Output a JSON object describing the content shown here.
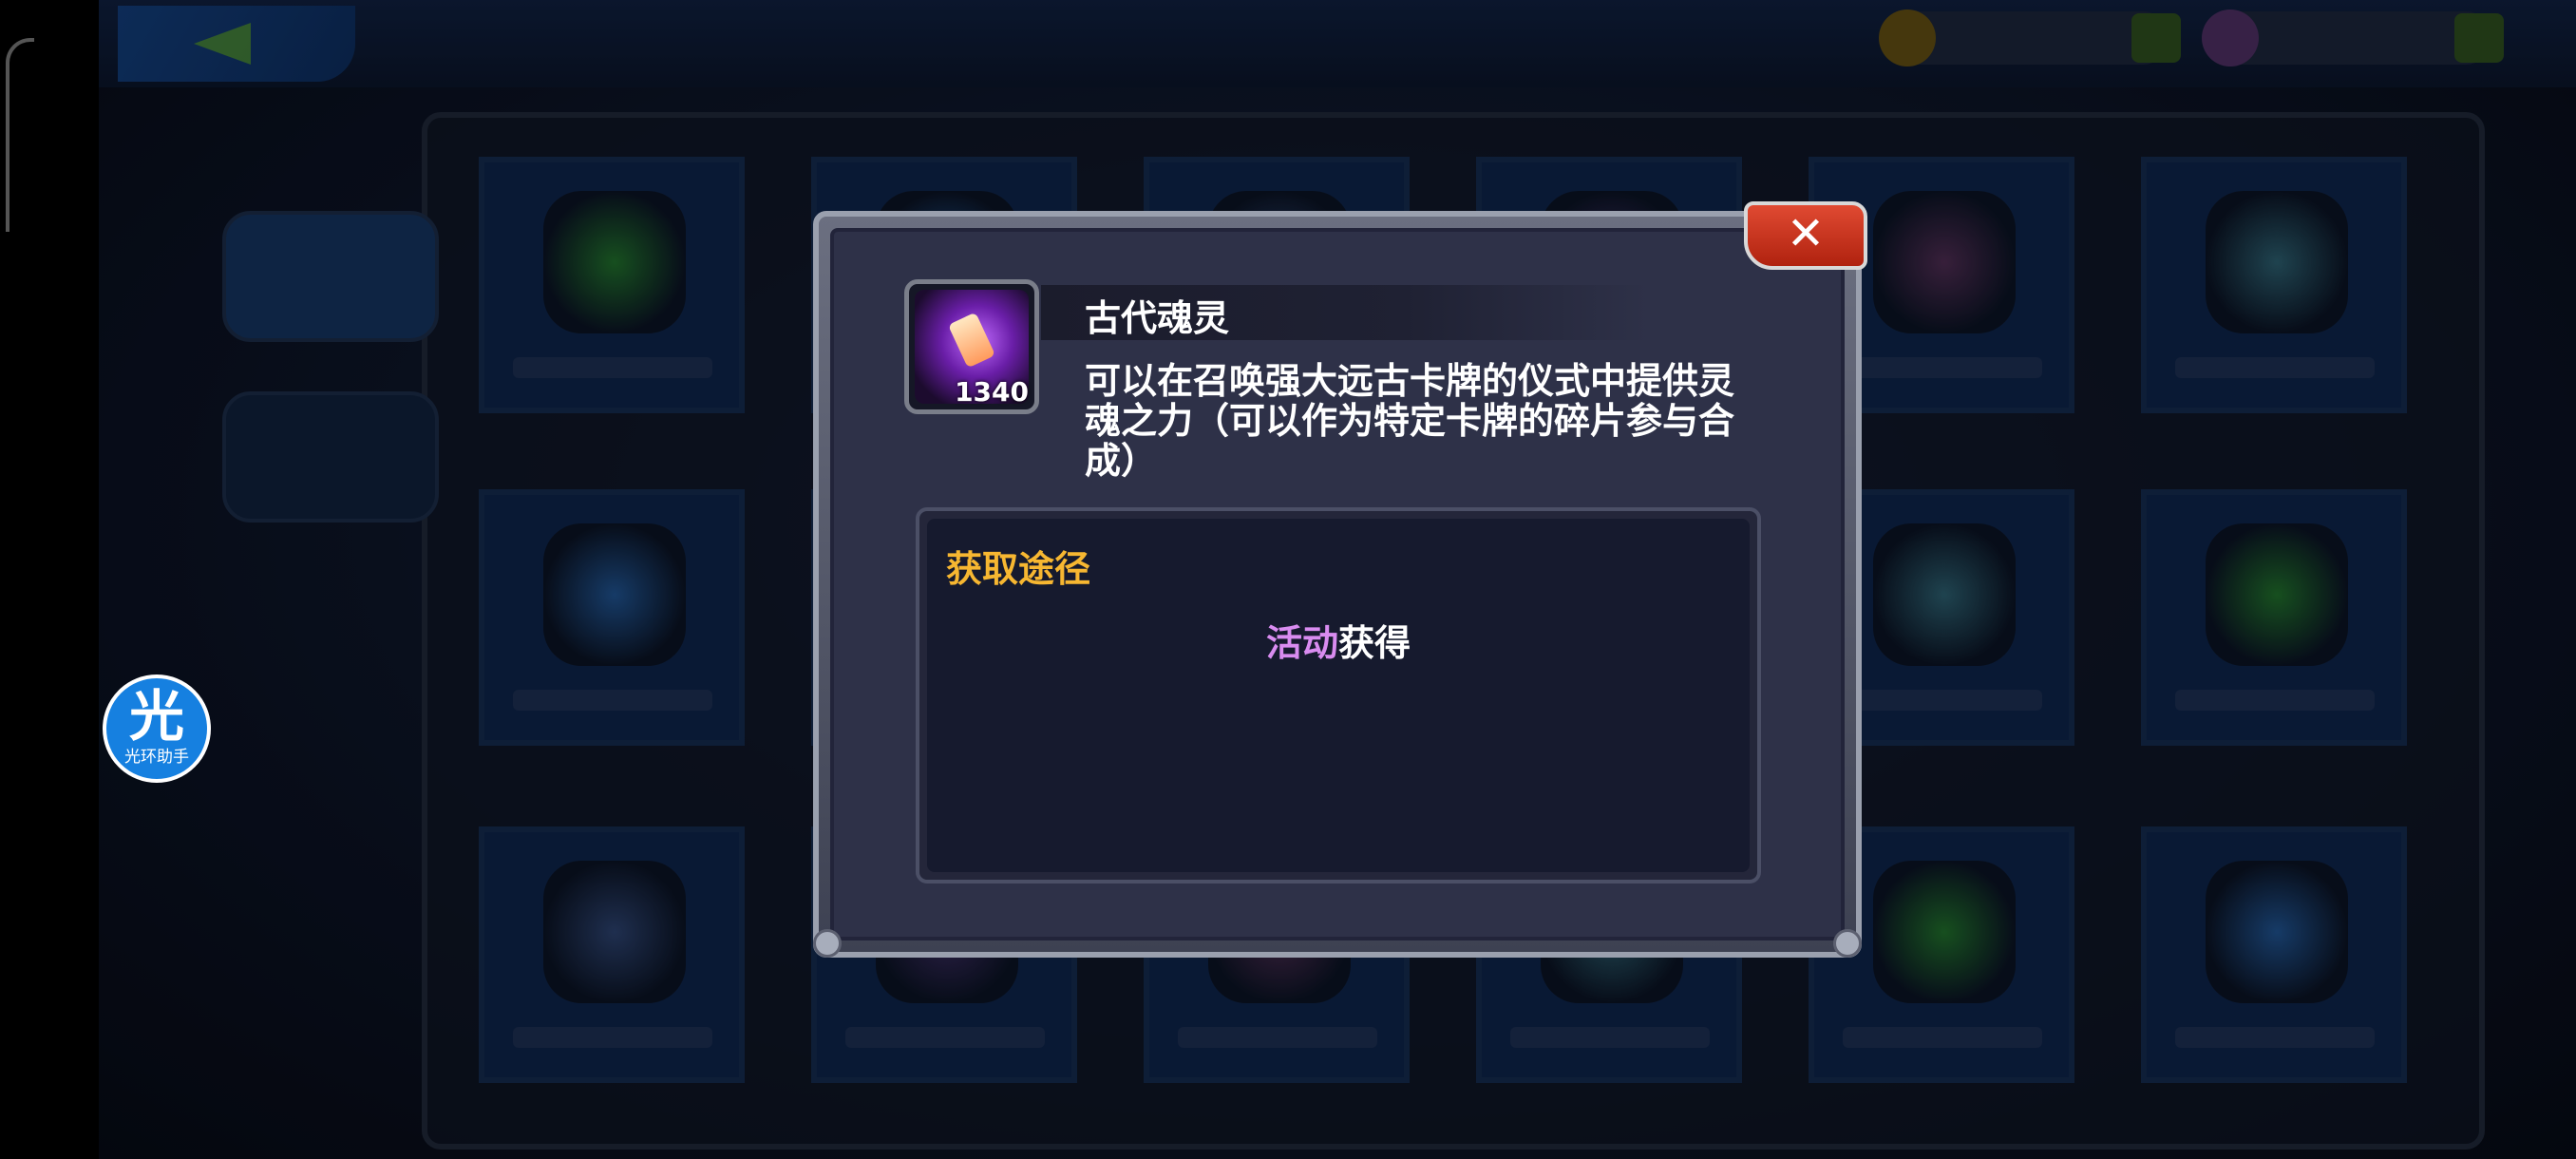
{
  "dialog": {
    "item_name": "古代魂灵",
    "item_count": "1340",
    "description": "可以在召唤强大远古卡牌的仪式中提供灵魂之力（可以作为特定卡牌的碎片参与合成）",
    "close_label": "✕",
    "source": {
      "title": "获取途径",
      "highlight": "活动",
      "text": "获得"
    }
  },
  "helper": {
    "glyph": "光",
    "label": "光环助手"
  },
  "colors": {
    "source_title": "#f7b731",
    "source_highlight": "#d98cf0",
    "close_button": "#c8321c",
    "dialog_bg": "#2e3148"
  }
}
